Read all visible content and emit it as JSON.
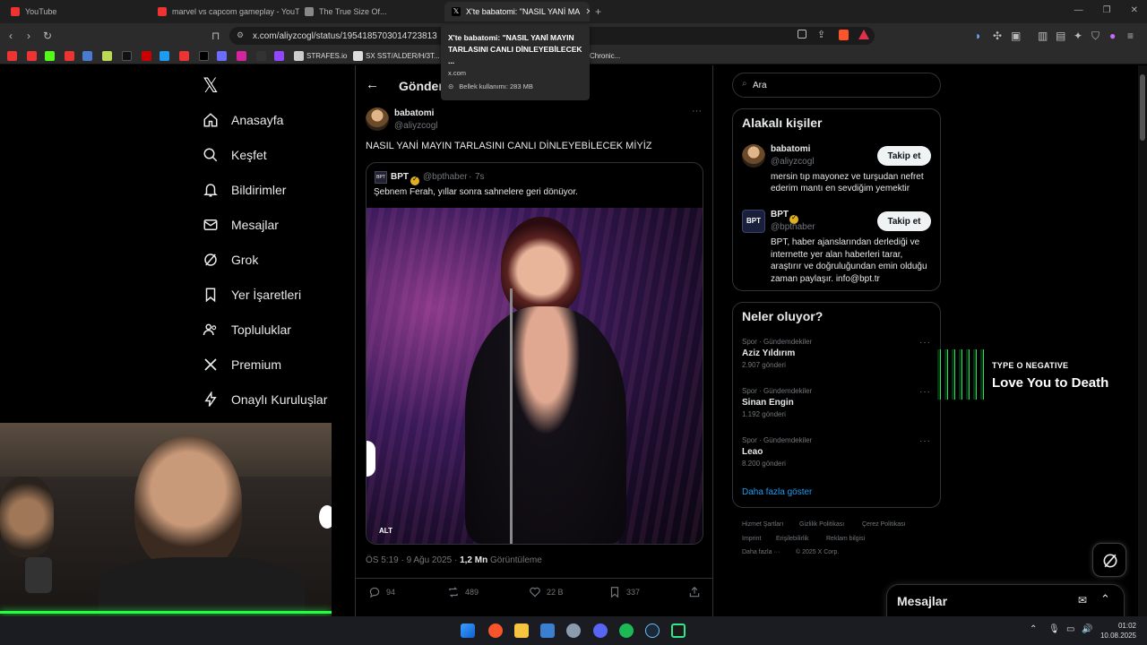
{
  "browser": {
    "tabs": [
      {
        "label": "YouTube",
        "favicon": "youtube-icon"
      },
      {
        "label": "marvel vs capcom gameplay - YouTu",
        "favicon": "youtube-icon"
      },
      {
        "label": "The True Size Of...",
        "favicon": "page-icon"
      },
      {
        "label": "X'te babatomi: \"NASIL YANİ MA",
        "favicon": "x-icon"
      }
    ],
    "url": "x.com/aliyzcogl/status/1954185703014723813",
    "bookmarks": [
      {
        "label": "STRAFES.io"
      },
      {
        "label": "SX SST/ALDER/H/3T..."
      },
      {
        "label": "Chronic..."
      }
    ],
    "tooltip": {
      "title": "X'te babatomi: \"NASIL YANİ MAYIN TARLASINI CANLI DİNLEYEBİLECEK ...",
      "domain": "x.com",
      "memory": "Bellek kullanımı: 283 MB"
    }
  },
  "sidebar": {
    "items": [
      {
        "label": "Anasayfa",
        "icon": "home-icon"
      },
      {
        "label": "Keşfet",
        "icon": "search-icon"
      },
      {
        "label": "Bildirimler",
        "icon": "bell-icon"
      },
      {
        "label": "Mesajlar",
        "icon": "mail-icon"
      },
      {
        "label": "Grok",
        "icon": "grok-icon"
      },
      {
        "label": "Yer İşaretleri",
        "icon": "bookmark-icon"
      },
      {
        "label": "Topluluklar",
        "icon": "people-icon"
      },
      {
        "label": "Premium",
        "icon": "x-logo-icon"
      },
      {
        "label": "Onaylı Kuruluşlar",
        "icon": "lightning-icon"
      }
    ]
  },
  "main": {
    "header_title": "Gönder",
    "post": {
      "display_name": "babatomi",
      "handle": "@aliyzcogl",
      "text": "NASIL YANİ MAYIN TARLASINI CANLI DİNLEYEBİLECEK MİYİZ",
      "quote": {
        "display_name": "BPT",
        "handle": "@bpthaber",
        "time": "7s",
        "text": "Şebnem Ferah, yıllar sonra sahnelere geri dönüyor.",
        "alt_badge": "ALT"
      },
      "timestamp": "ÖS 5:19 · 9 Ağu 2025 ·",
      "views_count": "1,2 Mn",
      "views_label": "Görüntüleme",
      "actions": {
        "replies": "94",
        "reposts": "489",
        "likes": "22 B",
        "bookmarks": "337"
      }
    }
  },
  "right": {
    "search_placeholder": "Ara",
    "related": {
      "title": "Alakalı kişiler",
      "people": [
        {
          "name": "babatomi",
          "handle": "@aliyzcogl",
          "bio": "mersin tıp mayonez ve turşudan nefret ederim mantı en sevdiğim yemektir",
          "button": "Takip et"
        },
        {
          "name": "BPT",
          "handle": "@bpthaber",
          "bio": "BPT, haber ajanslarından derlediği ve internette yer alan haberleri tarar, araştırır ve doğruluğundan emin olduğu zaman paylaşır. info@bpt.tr",
          "button": "Takip et"
        }
      ]
    },
    "trends": {
      "title": "Neler oluyor?",
      "items": [
        {
          "category": "Spor · Gündemdekiler",
          "name": "Aziz Yıldırım",
          "count": "2.907 gönderi"
        },
        {
          "category": "Spor · Gündemdekiler",
          "name": "Sinan Engin",
          "count": "1.192 gönderi"
        },
        {
          "category": "Spor · Gündemdekiler",
          "name": "Leao",
          "count": "8.200 gönderi"
        }
      ],
      "more": "Daha fazla göster"
    },
    "footer": {
      "links": [
        "Hizmet Şartları",
        "Gizlilik Politikası",
        "Çerez Politikası",
        "Imprint",
        "Erişilebilirlik",
        "Reklam bilgisi",
        "Daha fazla ···",
        "© 2025 X Corp."
      ]
    },
    "messages_drawer": "Mesajlar"
  },
  "overlay": {
    "music_artist": "TYPE O NEGATIVE",
    "music_title": "Love You to Death"
  },
  "taskbar": {
    "time": "01:02",
    "date": "10.08.2025"
  },
  "colors": {
    "background": "#000000",
    "border": "#2f3336",
    "muted": "#71767b",
    "verified": "#e0b020",
    "link": "#1d9bf0",
    "webcam_glow": "#22ff44"
  }
}
